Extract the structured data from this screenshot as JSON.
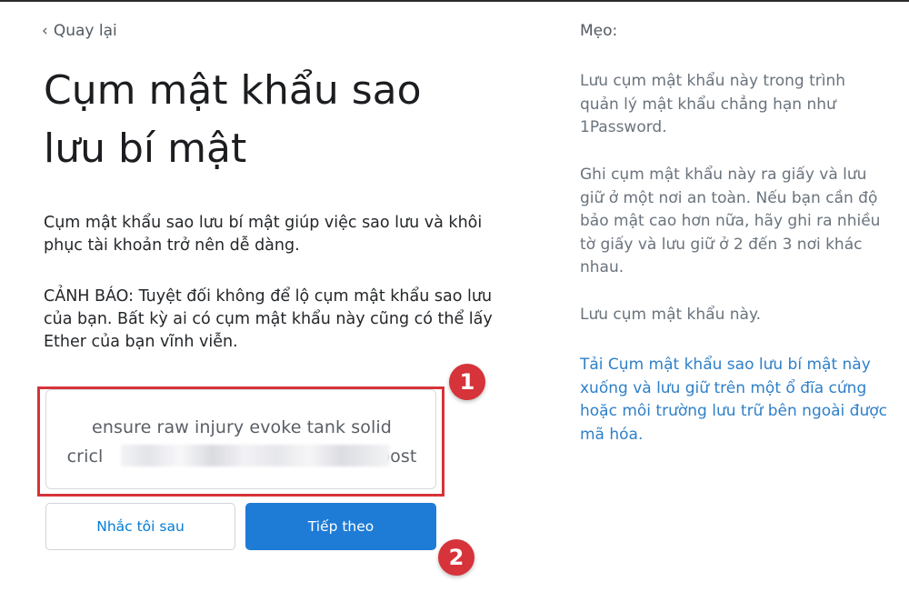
{
  "nav": {
    "back_label": "Quay lại"
  },
  "main": {
    "title": "Cụm mật khẩu sao lưu bí mật",
    "description": "Cụm mật khẩu sao lưu bí mật giúp việc sao lưu và khôi phục tài khoản trở nên dễ dàng.",
    "warning": "CẢNH BÁO: Tuyệt đối không để lộ cụm mật khẩu sao lưu của bạn. Bất kỳ ai có cụm mật khẩu này cũng có thể lấy Ether của bạn vĩnh viễn.",
    "phrase_line1": "ensure raw injury evoke tank solid",
    "phrase_line2_start": "cricl",
    "phrase_line2_end": "oost"
  },
  "buttons": {
    "remind_later": "Nhắc tôi sau",
    "next": "Tiếp theo"
  },
  "annotations": {
    "step1": "1",
    "step2": "2"
  },
  "tips": {
    "title": "Mẹo:",
    "items": [
      "Lưu cụm mật khẩu này trong trình quản lý mật khẩu chẳng hạn như 1Password.",
      "Ghi cụm mật khẩu này ra giấy và lưu giữ ở một nơi an toàn. Nếu bạn cần độ bảo mật cao hơn nữa, hãy ghi ra nhiều tờ giấy và lưu giữ ở 2 đến 3 nơi khác nhau.",
      "Lưu cụm mật khẩu này."
    ],
    "download_link": "Tải Cụm mật khẩu sao lưu bí mật này xuống và lưu giữ trên một ổ đĩa cứng hoặc môi trường lưu trữ bên ngoài được mã hóa."
  },
  "colors": {
    "accent": "#1e7cd6",
    "link": "#037dd6",
    "callout": "#d6333a"
  }
}
